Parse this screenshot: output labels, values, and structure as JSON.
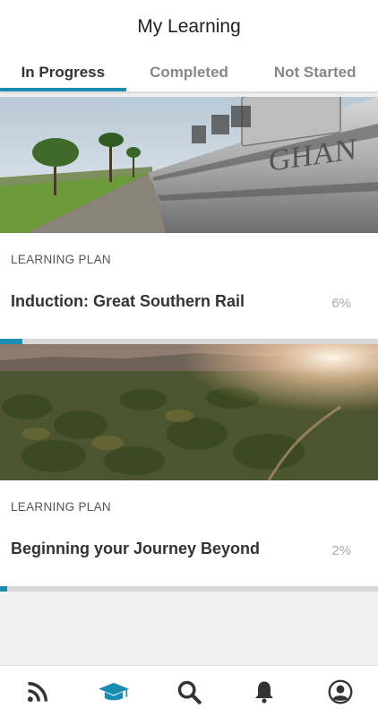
{
  "header": {
    "title": "My Learning"
  },
  "tabs": [
    {
      "label": "In Progress",
      "active": true
    },
    {
      "label": "Completed",
      "active": false
    },
    {
      "label": "Not Started",
      "active": false
    }
  ],
  "cards": [
    {
      "type_label": "LEARNING PLAN",
      "title": "Induction: Great Southern Rail",
      "percent_text": "6%",
      "progress": 0.06,
      "image": "train-ghan-photo"
    },
    {
      "type_label": "LEARNING PLAN",
      "title": "Beginning your Journey Beyond",
      "percent_text": "2%",
      "progress": 0.02,
      "image": "outback-sunset-photo"
    }
  ],
  "bottom_nav": [
    {
      "icon": "rss-feed-icon",
      "active": false
    },
    {
      "icon": "graduation-cap-icon",
      "active": true
    },
    {
      "icon": "search-icon",
      "active": false
    },
    {
      "icon": "bell-icon",
      "active": false
    },
    {
      "icon": "profile-icon",
      "active": false
    }
  ],
  "colors": {
    "accent": "#1a8db3",
    "inactive_icon": "#333333"
  }
}
